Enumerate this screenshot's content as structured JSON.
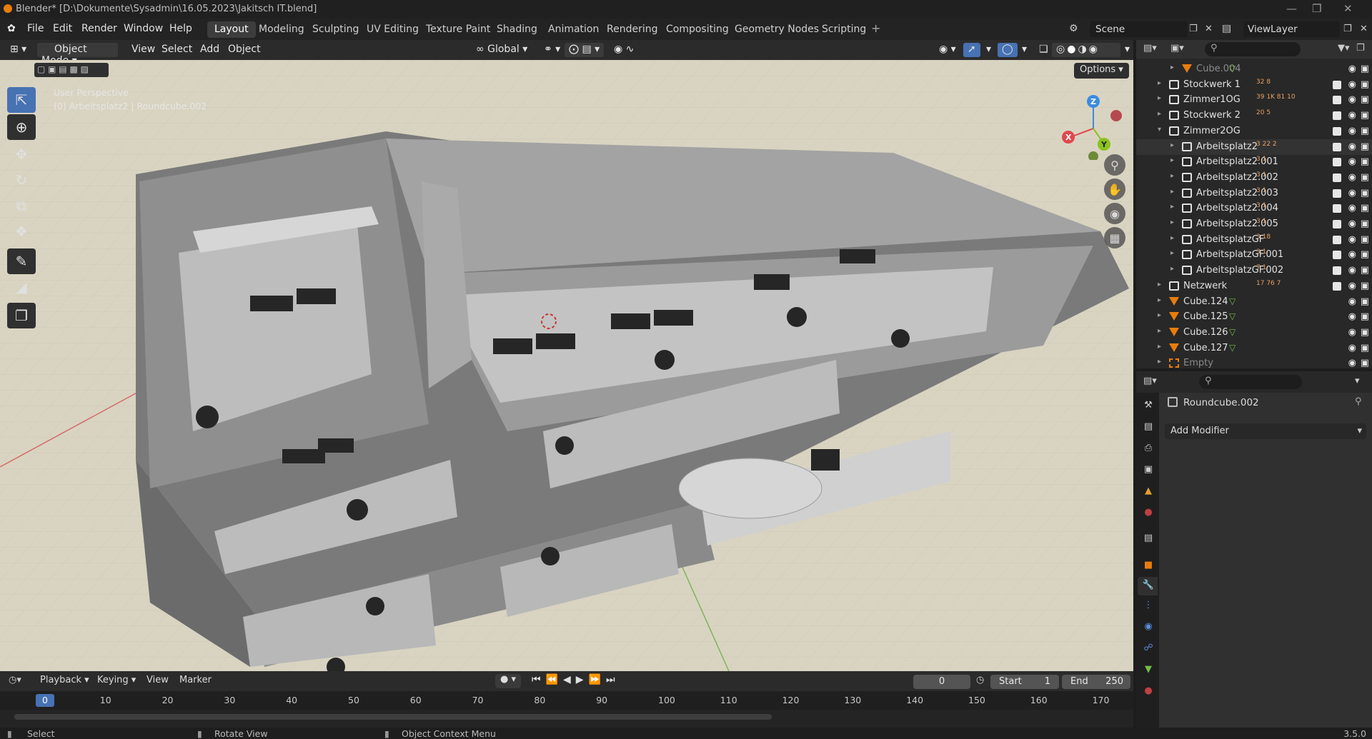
{
  "title_bar": {
    "title": "Blender* [D:\\Dokumente\\Sysadmin\\16.05.2023\\Jakitsch IT.blend]"
  },
  "menu": [
    "File",
    "Edit",
    "Render",
    "Window",
    "Help"
  ],
  "workspaces": [
    "Layout",
    "Modeling",
    "Sculpting",
    "UV Editing",
    "Texture Paint",
    "Shading",
    "Animation",
    "Rendering",
    "Compositing",
    "Geometry Nodes",
    "Scripting"
  ],
  "active_workspace": "Layout",
  "scene": {
    "label": "Scene",
    "viewlayer": "ViewLayer"
  },
  "viewport_header": {
    "mode": "Object Mode",
    "items": [
      "View",
      "Select",
      "Add",
      "Object"
    ],
    "orientation": "Global"
  },
  "viewport": {
    "perspective": "User Perspective",
    "context": "(0) Arbeitsplatz2 | Roundcube.002",
    "options": "Options",
    "gizmo": {
      "x": "X",
      "y": "Y",
      "z": "Z"
    }
  },
  "outliner": {
    "rows": [
      {
        "label": "Cube.004",
        "type": "mesh",
        "indent": 2,
        "dim": true
      },
      {
        "label": "Stockwerk 1",
        "type": "collection",
        "indent": 1,
        "counts": "32 8"
      },
      {
        "label": "Zimmer1OG",
        "type": "collection",
        "indent": 1,
        "counts": "39 1K 81 10"
      },
      {
        "label": "Stockwerk 2",
        "type": "collection",
        "indent": 1,
        "counts": "20 5"
      },
      {
        "label": "Zimmer2OG",
        "type": "collection",
        "indent": 1,
        "expanded": true
      },
      {
        "label": "Arbeitsplatz2",
        "type": "collection",
        "indent": 2,
        "counts": "3 22 2"
      },
      {
        "label": "Arbeitsplatz2.001",
        "type": "collection",
        "indent": 2,
        "counts": "3 1"
      },
      {
        "label": "Arbeitsplatz2.002",
        "type": "collection",
        "indent": 2,
        "counts": "3 1"
      },
      {
        "label": "Arbeitsplatz2.003",
        "type": "collection",
        "indent": 2,
        "counts": "3 1"
      },
      {
        "label": "Arbeitsplatz2.004",
        "type": "collection",
        "indent": 2,
        "counts": "3 1"
      },
      {
        "label": "Arbeitsplatz2.005",
        "type": "collection",
        "indent": 2,
        "counts": "3 1"
      },
      {
        "label": "ArbeitsplatzGF",
        "type": "collection",
        "indent": 2,
        "counts": "3 18"
      },
      {
        "label": "ArbeitsplatzGF.001",
        "type": "collection",
        "indent": 2,
        "counts": "3 1"
      },
      {
        "label": "ArbeitsplatzGF.002",
        "type": "collection",
        "indent": 2,
        "counts": "7 1"
      },
      {
        "label": "Netzwerk",
        "type": "collection",
        "indent": 1,
        "counts": "17 76 7"
      },
      {
        "label": "Cube.124",
        "type": "mesh",
        "indent": 1
      },
      {
        "label": "Cube.125",
        "type": "mesh",
        "indent": 1
      },
      {
        "label": "Cube.126",
        "type": "mesh",
        "indent": 1
      },
      {
        "label": "Cube.127",
        "type": "mesh",
        "indent": 1
      },
      {
        "label": "Empty",
        "type": "empty",
        "indent": 1,
        "dim": true
      }
    ]
  },
  "properties": {
    "object": "Roundcube.002",
    "add_modifier": "Add Modifier"
  },
  "timeline": {
    "menus": [
      "Playback",
      "Keying",
      "View",
      "Marker"
    ],
    "current": "0",
    "start_label": "Start",
    "start": "1",
    "end_label": "End",
    "end": "250",
    "ticks": [
      "0",
      "10",
      "20",
      "30",
      "40",
      "50",
      "60",
      "70",
      "80",
      "90",
      "100",
      "110",
      "120",
      "130",
      "140",
      "150",
      "160",
      "170"
    ]
  },
  "status": {
    "select": "Select",
    "rotate": "Rotate View",
    "context": "Object Context Menu",
    "version": "3.5.0"
  },
  "colors": {
    "accent": "#4772b3",
    "orange": "#e87d0d",
    "x_axis": "#e0474d",
    "y_axis": "#8cc21f",
    "z_axis": "#3b8be0"
  }
}
